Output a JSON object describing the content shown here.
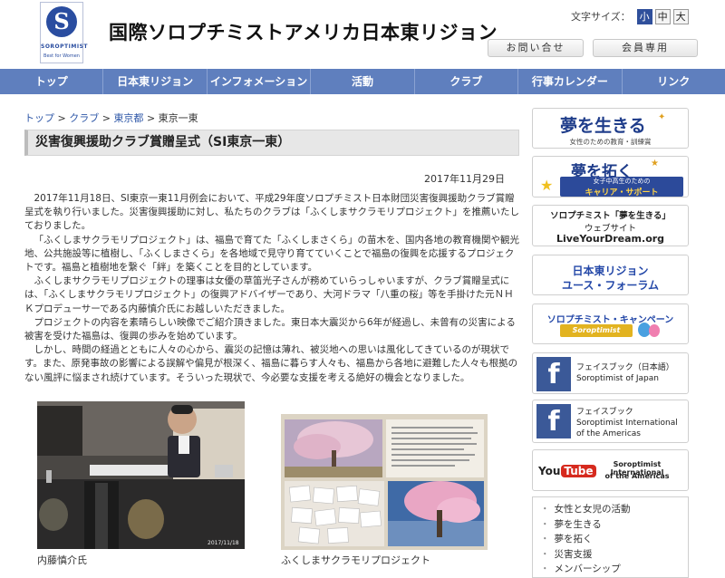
{
  "header": {
    "org_name": "国際ソロプチミストアメリカ日本東リジョン",
    "logo_word": "SOROPTIMIST",
    "logo_tag": "Best for Women",
    "font_size_label": "文字サイズ：",
    "font_sizes": [
      "小",
      "中",
      "大"
    ],
    "contact_btn": "お問い合せ",
    "members_btn": "会員専用"
  },
  "nav": [
    "トップ",
    "日本東リジョン",
    "インフォメーション",
    "活動",
    "クラブ",
    "行事カレンダー",
    "リンク"
  ],
  "breadcrumb": {
    "items": [
      "トップ",
      "クラブ",
      "東京都",
      "東京一東"
    ],
    "sep": ">"
  },
  "article": {
    "title": "災害復興援助クラブ賞贈呈式（SI東京一東）",
    "date": "2017年11月29日",
    "paragraphs": [
      "2017年11月18日、SI東京一東11月例会において、平成29年度ソロプチミスト日本財団災害復興援助クラブ賞贈呈式を執り行いました。災害復興援助に対し、私たちのクラブは「ふくしまサクラモリプロジェクト」を推薦いたしておりました。",
      "「ふくしまサクラモリプロジェクト」は、福島で育てた「ふくしまさくら」の苗木を、国内各地の教育機関や観光地、公共施設等に植樹し、「ふくしまさくら」を各地域で見守り育てていくことで福島の復興を応援するプロジェクトです。福島と植樹地を繋ぐ「絆」を築くことを目的としています。",
      "ふくしまサクラモリプロジェクトの理事は女優の草笛光子さんが務めていらっしゃいますが、クラブ賞贈呈式には、「ふくしまサクラモリプロジェクト」の復興アドバイザーであり、大河ドラマ「八重の桜」等を手掛けた元ＮＨＫプロデューサーである内藤慎介氏にお越しいただきました。",
      "プロジェクトの内容を素晴らしい映像でご紹介頂きました。東日本大震災から6年が経過し、未曾有の災害による被害を受けた福島は、復興の歩みを始めています。",
      "しかし、時間の経過とともに人々の心から、震災の記憶は薄れ、被災地への思いは風化してきているのが現状です。また、原発事故の影響による誤解や偏見が根深く、福島に暮らす人々も、福島から各地に避難した人々も根拠のない風評に悩まされ続けています。そういった現状で、今必要な支援を考える絶好の機会となりました。"
    ],
    "photo1_caption": "内藤慎介氏",
    "photo1_stamp": "2017/11/18",
    "photo2_caption": "ふくしまサクラモリプロジェクト"
  },
  "sidebar": {
    "dream": {
      "title": "夢を生きる",
      "sub": "女性のための教育・訓練賞"
    },
    "takuku": {
      "title": "夢を拓く",
      "sub1": "女子中高生のための",
      "sub2": "キャリア・サポート"
    },
    "liveyourdream": {
      "line1": "ソロプチミスト「夢を生きる」",
      "line2": "ウェブサイト",
      "line3": "LiveYourDream.org"
    },
    "youth": {
      "line1": "日本東リジョン",
      "line2": "ユース・フォーラム"
    },
    "campaign": {
      "title": "ソロプチミスト・キャンペーン",
      "ribbon": "Soroptimist"
    },
    "fb_japan": {
      "label": "フェイスブック（日本語）",
      "name": "Soroptimist of Japan"
    },
    "fb_intl": {
      "label": "フェイスブック",
      "name1": "Soroptimist International",
      "name2": "of the Americas"
    },
    "youtube": {
      "you": "You",
      "tube": "Tube",
      "name1": "Soroptimist International",
      "name2": "of the Americas"
    },
    "menu": [
      "女性と女児の活動",
      "夢を生きる",
      "夢を拓く",
      "災害支援",
      "メンバーシップ"
    ]
  },
  "colors": {
    "nav": "#5f7fbe",
    "brand": "#2a4da0",
    "facebook": "#3b5998",
    "link": "#2f58a8"
  }
}
